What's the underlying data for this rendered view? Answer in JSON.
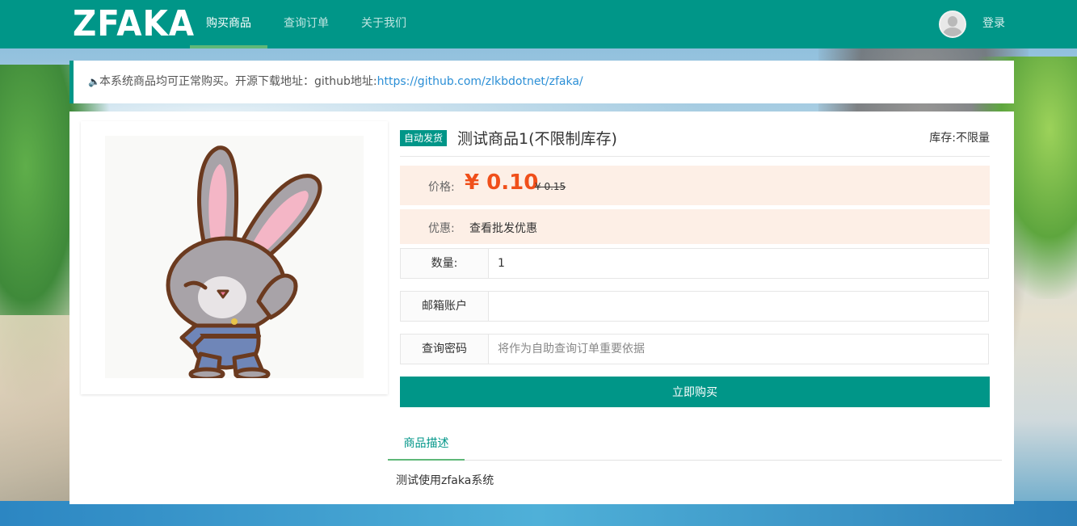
{
  "header": {
    "logo": "ZFAKA",
    "nav": [
      "购买商品",
      "查询订单",
      "关于我们"
    ],
    "login": "登录"
  },
  "notice": {
    "text": "本系统商品均可正常购买。开源下载地址：github地址:",
    "link": "https://github.com/zlkbdotnet/zfaka/"
  },
  "product": {
    "badge": "自动发货",
    "title": "测试商品1(不限制库存)",
    "stock": "库存:不限量",
    "price_label": "价格:",
    "price": "¥ 0.10",
    "old_price": "¥ 0.15",
    "promo_label": "优惠:",
    "promo_link": "查看批发优惠",
    "qty_label": "数量:",
    "qty_value": "1",
    "email_label": "邮箱账户",
    "email_value": "",
    "pwd_label": "查询密码",
    "pwd_placeholder": "将作为自助查询订单重要依据",
    "buy_button": "立即购买"
  },
  "tabs": {
    "description_tab": "商品描述",
    "description_text": "测试使用zfaka系统"
  },
  "colors": {
    "primary": "#009688",
    "accent": "#5FB878",
    "price": "#f04f1a",
    "price_bg": "#fdefe6",
    "link": "#2b8fd6"
  }
}
